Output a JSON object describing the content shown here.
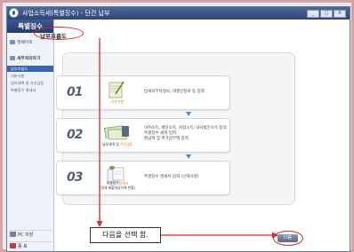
{
  "window": {
    "title": "사업소득세(특별징수) - 단건 납부",
    "buttons": [
      "_",
      "□",
      "X"
    ]
  },
  "sidebar": {
    "header": "특별징수",
    "home": "첫페이지",
    "section": "세무처리하기",
    "items": [
      "납부흐름도",
      "기본사항",
      "납부세액 및 가산금등",
      "특별징수 명세서"
    ],
    "bottom": [
      "PC 저장",
      "종 료"
    ]
  },
  "main": {
    "tab_label": "납부흐름도",
    "steps": [
      {
        "num": "01",
        "caption_pre": "",
        "caption_hl": "기본사항",
        "caption_post": "",
        "text": [
          "납세의무자정보, 대행인정보 등 입력"
        ]
      },
      {
        "num": "02",
        "caption_pre": "납부세액 및 ",
        "caption_hl": "가산금등",
        "caption_post": "",
        "text": [
          "이자소득, 배당소득, 사업소득, 내국법인소득 등의",
          "특별징수 세액 입력",
          "환급액 및 추가납부액 입력"
        ]
      },
      {
        "num": "03",
        "caption_pre": "특별징수",
        "caption_hl": "명세서",
        "caption_post": "",
        "caption2": "(명세 제출대상자에 한함)",
        "text": [
          "특별징수 명세서 입력 (선택사항)"
        ]
      }
    ],
    "callout": "다음을 선택 함.",
    "next_button": "다음"
  },
  "colors": {
    "title_bar": "#2f4577",
    "accent_red": "#d72a2a",
    "highlight_orange": "#e17a1e",
    "arrow_blue": "#4d8ad8"
  }
}
